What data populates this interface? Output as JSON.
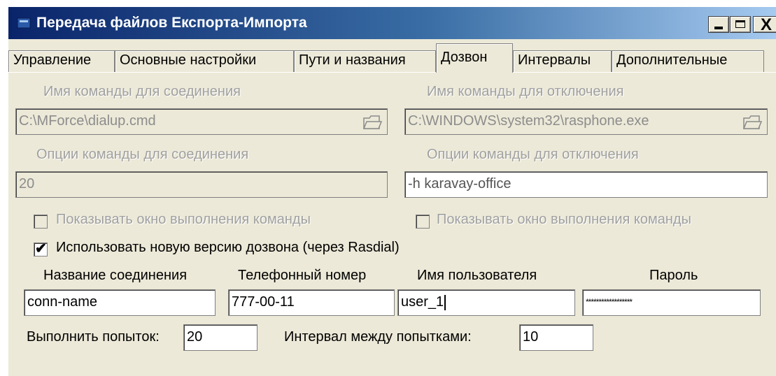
{
  "window": {
    "title": "Передача файлов Експорта-Импорта",
    "minimize_icon": "minimize-icon",
    "maximize_icon": "maximize-icon",
    "close_glyph": "X"
  },
  "tabs": [
    {
      "label": "Управление",
      "active": false
    },
    {
      "label": "Основные настройки",
      "active": false
    },
    {
      "label": "Пути и названия",
      "active": false
    },
    {
      "label": "Дозвон",
      "active": true
    },
    {
      "label": "Интервалы",
      "active": false
    },
    {
      "label": "Дополнительные",
      "active": false
    }
  ],
  "connect": {
    "cmd_label": "Имя команды для соединения",
    "cmd_value": "C:\\MForce\\dialup.cmd",
    "opts_label": "Опции команды для соединения",
    "opts_value": "20",
    "show_window_label": "Показывать окно выполнения команды"
  },
  "disconnect": {
    "cmd_label": "Имя команды для  отключения",
    "cmd_value": "C:\\WINDOWS\\system32\\rasphone.exe",
    "opts_label": "Опции команды для отключения",
    "opts_value": "-h karavay-office",
    "show_window_label": "Показывать окно выполнения команды"
  },
  "rasdial": {
    "label": "Использовать новую версию дозвона (через Rasdial)",
    "checked": true
  },
  "dial": {
    "conn_name_label": "Название соединения",
    "conn_name_value": "conn-name",
    "phone_label": "Телефонный номер",
    "phone_value": "777-00-11",
    "user_label": "Имя пользователя",
    "user_value": "user_1",
    "password_label": "Пароль",
    "password_value": "******************"
  },
  "retries": {
    "attempts_label": "Выполнить попыток:",
    "attempts_value": "20",
    "interval_label": "Интервал между попытками:",
    "interval_value": "10"
  },
  "icons": {
    "app": "app-icon",
    "browse": "folder-open-icon",
    "check": "checkmark-icon"
  },
  "colors": {
    "title_start": "#0a246a",
    "title_end": "#a6caf0",
    "dialog_bg": "#ece9d8",
    "disabled_text": "#a0a0a0"
  }
}
